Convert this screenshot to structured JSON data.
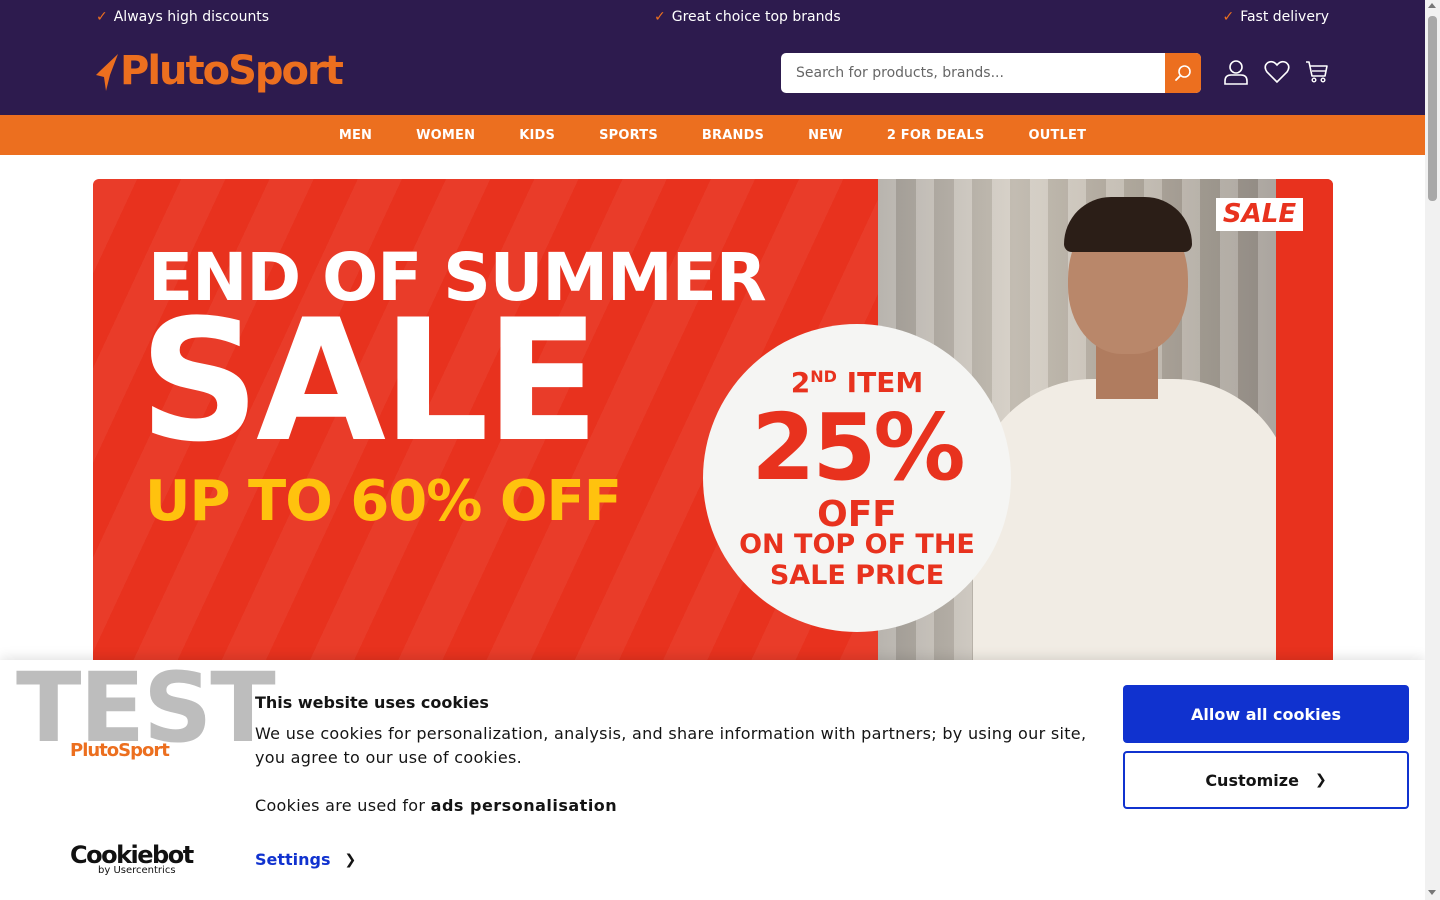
{
  "usp": [
    {
      "label": "Always high discounts"
    },
    {
      "label": "Great choice top brands"
    },
    {
      "label": "Fast delivery"
    }
  ],
  "logo": {
    "text": "PlutoSport"
  },
  "search": {
    "placeholder": "Search for products, brands..."
  },
  "header_icons": [
    "user-icon",
    "heart-icon",
    "cart-icon"
  ],
  "nav": [
    "MEN",
    "WOMEN",
    "KIDS",
    "SPORTS",
    "BRANDS",
    "NEW",
    "2 FOR DEALS",
    "OUTLET"
  ],
  "banner": {
    "headline_1": "END OF SUMMER",
    "headline_2": "SALE",
    "headline_3": "UP TO 60% OFF",
    "sale_tag": "SALE",
    "circle": {
      "item_prefix": "2",
      "item_sup": "ND",
      "item_label": " ITEM",
      "percent": "25%",
      "off": "OFF",
      "line_1": "ON TOP OF THE",
      "line_2": "SALE PRICE"
    }
  },
  "cookie": {
    "watermark": "TEST",
    "brand": "PlutoSport",
    "title": "This website uses cookies",
    "text": "We use cookies for personalization, analysis, and share information with partners; by using our site, you agree to our use of cookies.",
    "purpose_prefix": "Cookies are used for",
    "purpose_value": "ads personalisation",
    "settings_label": "Settings",
    "allow_label": "Allow all cookies",
    "customize_label": "Customize",
    "cookiebot_name": "Cookiebot",
    "cookiebot_sub": "by Usercentrics"
  },
  "colors": {
    "header_bg": "#2d1b4e",
    "brand_orange": "#ec6f1f",
    "banner_red": "#e8321e",
    "banner_yellow": "#ffc20e",
    "cookie_blue": "#1032cf"
  }
}
